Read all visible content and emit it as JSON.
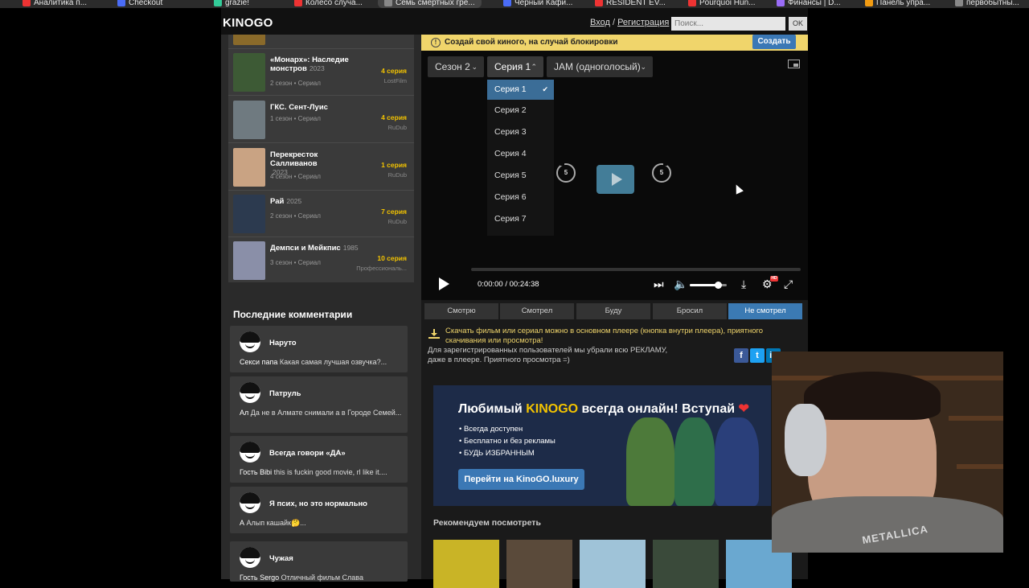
{
  "bookmarks": [
    {
      "label": "Аналитика п...",
      "color": "#e33"
    },
    {
      "label": "Checkout",
      "color": "#4a6cf7"
    },
    {
      "label": "grazie!",
      "color": "#3c9"
    },
    {
      "label": "Колесо случа...",
      "color": "#e33"
    },
    {
      "label": "Семь смертных гре...",
      "color": "#888"
    },
    {
      "label": "Черный Кафи...",
      "color": "#4a6cf7"
    },
    {
      "label": "RESIDENT EV...",
      "color": "#e33"
    },
    {
      "label": "Pourquoi Hun...",
      "color": "#e33"
    },
    {
      "label": "Финансы | D...",
      "color": "#9a6cf7"
    },
    {
      "label": "Панель упра...",
      "color": "#f39c12"
    },
    {
      "label": "первобытны...",
      "color": "#888"
    }
  ],
  "site": {
    "logo": "KINOGO",
    "login": "Вход",
    "separator": "/",
    "register": "Регистрация",
    "search_placeholder": "Поиск...",
    "search_button": "OK"
  },
  "series": [
    {
      "title": "«Монарх»: Наследие монстров",
      "year": "2023",
      "meta": "2 сезон • Сериал",
      "episode": "4 серия",
      "studio": "LostFilm",
      "poster_color": "#3d5a35"
    },
    {
      "title": "ГКС. Сент-Луис",
      "year": "",
      "meta": "1 сезон • Сериал",
      "episode": "4 серия",
      "studio": "RuDub",
      "poster_color": "#6f7a80"
    },
    {
      "title": "Перекресток Салливанов",
      "year": "2023",
      "meta": "4 сезон • Сериал",
      "episode": "1 серия",
      "studio": "RuDub",
      "poster_color": "#c9a383"
    },
    {
      "title": "Рай",
      "year": "2025",
      "meta": "2 сезон • Сериал",
      "episode": "7 серия",
      "studio": "RuDub",
      "poster_color": "#2c3a4f"
    },
    {
      "title": "Демпси и Мейкпис",
      "year": "1985",
      "meta": "3 сезон • Сериал",
      "episode": "10 серия",
      "studio": "Профессиональ...",
      "poster_color": "#8a8fa8"
    }
  ],
  "comments_title": "Последние комментарии",
  "comments": [
    {
      "name": "Наруто",
      "author": "Секси папа",
      "text": "Какая самая лучшая озвучка?..."
    },
    {
      "name": "Патруль",
      "author": "Ал",
      "text": "Да не в Алмате снимали а в Городе Семей..."
    },
    {
      "name": "Всегда говори «ДА»",
      "author": "Гость Bibi",
      "text": "this is fuckin good movie, rl like it...."
    },
    {
      "name": "Я псих, но это нормально",
      "author": "А",
      "text": "Алып кашайк🤔..."
    },
    {
      "name": "Чужая",
      "author": "Гость Sergo",
      "text": "Отличный фильм Слава"
    }
  ],
  "promo": {
    "text": "Создай свой киного, на случай блокировки",
    "button": "Создать"
  },
  "player": {
    "season": "Сезон 2",
    "episode": "Серия 1",
    "voice": "JAM (одноголосый)",
    "episodes": [
      "Серия 1",
      "Серия 2",
      "Серия 3",
      "Серия 4",
      "Серия 5",
      "Серия 6",
      "Серия 7"
    ],
    "skip_back": "5",
    "skip_fwd": "5",
    "time": "0:00:00 / 00:24:38",
    "volume": 0.75,
    "hd_badge": "HD"
  },
  "status_tabs": [
    "Смотрю",
    "Смотрел",
    "Буду",
    "Бросил",
    "Не смотрел"
  ],
  "download_note": "Скачать фильм или сериал можно в основном плеере (кнопка внутри плеера), приятного скачивания или просмотра!",
  "ad_note": "Для зарегистрированных пользователей мы убрали всю РЕКЛАМУ, даже в плеере. Приятного просмотра =)",
  "banner": {
    "title_a": "Любимый",
    "title_kinogo": "KINOGO",
    "title_b": "всегда онлайн! Вступай",
    "heart": "❤",
    "bullets": [
      "Всегда доступен",
      "Бесплатно и без рекламы",
      "БУДЬ ИЗБРАННЫМ"
    ],
    "button": "Перейти на KinoGO.luxury"
  },
  "recommend_title": "Рекомендуем посмотреть",
  "webcam_shirt_text": "METALLICA"
}
